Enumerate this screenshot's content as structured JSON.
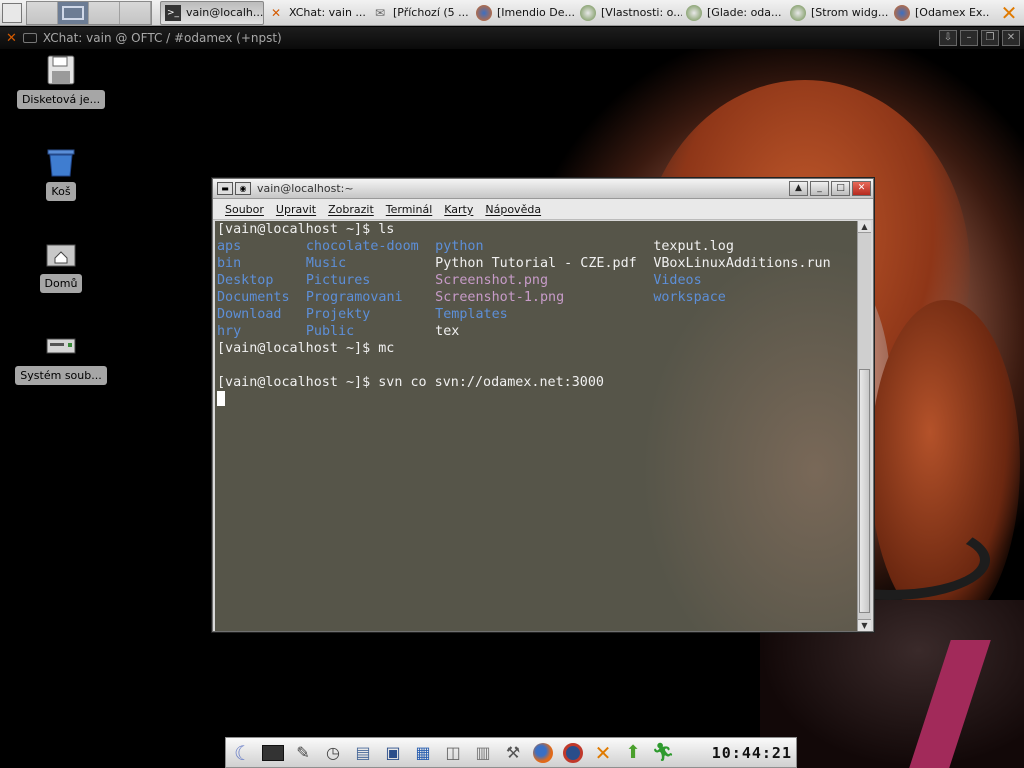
{
  "top_panel": {
    "tasks": [
      {
        "label": "vain@localh...",
        "icon": "terminal-icon",
        "active": true
      },
      {
        "label": "XChat: vain ...",
        "icon": "xchat-icon",
        "active": false
      },
      {
        "label": "[Příchozí (5 ...",
        "icon": "mail-icon",
        "active": false
      },
      {
        "label": "[Imendio De...",
        "icon": "firefox-icon",
        "active": false
      },
      {
        "label": "[Vlastnosti: o...",
        "icon": "glade-icon",
        "active": false
      },
      {
        "label": "[Glade: oda...",
        "icon": "glade-icon",
        "active": false
      },
      {
        "label": "[Strom widg...",
        "icon": "glade-icon",
        "active": false
      },
      {
        "label": "[Odamex Ex...",
        "icon": "firefox-icon",
        "active": false
      }
    ]
  },
  "xchat_window": {
    "title": "XChat: vain @ OFTC / #odamex (+npst)"
  },
  "desktop_icons": [
    {
      "label": "Disketová je...",
      "icon": "floppy-icon"
    },
    {
      "label": "Koš",
      "icon": "trash-icon"
    },
    {
      "label": "Domů",
      "icon": "home-folder-icon"
    },
    {
      "label": "Systém soub...",
      "icon": "drive-icon"
    }
  ],
  "terminal": {
    "title": "vain@localhost:~",
    "menu": [
      "Soubor",
      "Upravit",
      "Zobrazit",
      "Terminál",
      "Karty",
      "Nápověda"
    ],
    "lines": [
      [
        {
          "text": "[vain@localhost ~]$ ls",
          "kind": "plain",
          "col": 0
        }
      ],
      [
        {
          "text": "aps",
          "kind": "dir",
          "col": 0
        },
        {
          "text": "chocolate-doom",
          "kind": "dir",
          "col": 11
        },
        {
          "text": "python",
          "kind": "dir",
          "col": 27
        },
        {
          "text": "texput.log",
          "kind": "plain",
          "col": 54
        }
      ],
      [
        {
          "text": "bin",
          "kind": "dir",
          "col": 0
        },
        {
          "text": "Music",
          "kind": "dir",
          "col": 11
        },
        {
          "text": "Python Tutorial - CZE.pdf",
          "kind": "plain",
          "col": 27
        },
        {
          "text": "VBoxLinuxAdditions.run",
          "kind": "plain",
          "col": 54
        }
      ],
      [
        {
          "text": "Desktop",
          "kind": "dir",
          "col": 0
        },
        {
          "text": "Pictures",
          "kind": "dir",
          "col": 11
        },
        {
          "text": "Screenshot.png",
          "kind": "img-f",
          "col": 27
        },
        {
          "text": "Videos",
          "kind": "dir",
          "col": 54
        }
      ],
      [
        {
          "text": "Documents",
          "kind": "dir",
          "col": 0
        },
        {
          "text": "Programovani",
          "kind": "dir",
          "col": 11
        },
        {
          "text": "Screenshot-1.png",
          "kind": "img-f",
          "col": 27
        },
        {
          "text": "workspace",
          "kind": "dir",
          "col": 54
        }
      ],
      [
        {
          "text": "Download",
          "kind": "dir",
          "col": 0
        },
        {
          "text": "Projekty",
          "kind": "dir",
          "col": 11
        },
        {
          "text": "Templates",
          "kind": "dir",
          "col": 27
        }
      ],
      [
        {
          "text": "hry",
          "kind": "dir",
          "col": 0
        },
        {
          "text": "Public",
          "kind": "dir",
          "col": 11
        },
        {
          "text": "tex",
          "kind": "plain",
          "col": 27
        }
      ],
      [
        {
          "text": "[vain@localhost ~]$ mc",
          "kind": "plain",
          "col": 0
        }
      ],
      [],
      [
        {
          "text": "[vain@localhost ~]$ svn co svn://odamex.net:3000",
          "kind": "plain",
          "col": 0
        }
      ]
    ],
    "colors": {
      "dir": "#5d8fd8",
      "image": "#c79bc8",
      "text": "#f0f0f0",
      "background": "#565549"
    }
  },
  "dock": {
    "items": [
      {
        "icon": "kde-menu-icon"
      },
      {
        "icon": "terminal-icon"
      },
      {
        "icon": "text-editor-icon"
      },
      {
        "icon": "clock-app-icon"
      },
      {
        "icon": "file-manager-icon"
      },
      {
        "icon": "save-icon"
      },
      {
        "icon": "image-viewer-icon"
      },
      {
        "icon": "photos-icon"
      },
      {
        "icon": "archive-icon"
      },
      {
        "icon": "tools-icon"
      },
      {
        "icon": "firefox-icon"
      },
      {
        "icon": "media-player-icon"
      },
      {
        "icon": "xchat-icon"
      },
      {
        "icon": "update-icon"
      },
      {
        "icon": "run-icon"
      }
    ],
    "clock": "10:44:21"
  }
}
